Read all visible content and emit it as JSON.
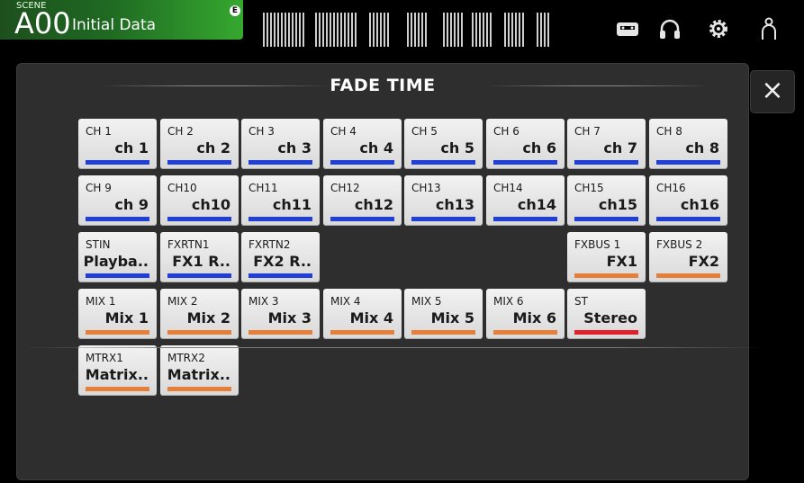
{
  "scene": {
    "label": "SCENE",
    "number": "A00",
    "name": "Initial Data",
    "badge": "E"
  },
  "panel": {
    "title": "FADE TIME",
    "close_label": "×"
  },
  "colors": {
    "blue": "#1f3fd6",
    "orange": "#e57f3a",
    "red": "#e0202a"
  },
  "rows": [
    [
      {
        "id": "CH 1",
        "name": "ch 1",
        "color": "blue"
      },
      {
        "id": "CH 2",
        "name": "ch 2",
        "color": "blue"
      },
      {
        "id": "CH 3",
        "name": "ch 3",
        "color": "blue"
      },
      {
        "id": "CH 4",
        "name": "ch 4",
        "color": "blue"
      },
      {
        "id": "CH 5",
        "name": "ch 5",
        "color": "blue"
      },
      {
        "id": "CH 6",
        "name": "ch 6",
        "color": "blue"
      },
      {
        "id": "CH 7",
        "name": "ch 7",
        "color": "blue"
      },
      {
        "id": "CH 8",
        "name": "ch 8",
        "color": "blue"
      }
    ],
    [
      {
        "id": "CH 9",
        "name": "ch 9",
        "color": "blue"
      },
      {
        "id": "CH10",
        "name": "ch10",
        "color": "blue"
      },
      {
        "id": "CH11",
        "name": "ch11",
        "color": "blue"
      },
      {
        "id": "CH12",
        "name": "ch12",
        "color": "blue"
      },
      {
        "id": "CH13",
        "name": "ch13",
        "color": "blue"
      },
      {
        "id": "CH14",
        "name": "ch14",
        "color": "blue"
      },
      {
        "id": "CH15",
        "name": "ch15",
        "color": "blue"
      },
      {
        "id": "CH16",
        "name": "ch16",
        "color": "blue"
      }
    ],
    [
      {
        "id": "STIN",
        "name": "Playba..",
        "color": "blue"
      },
      {
        "id": "FXRTN1",
        "name": "FX1 R..",
        "color": "blue"
      },
      {
        "id": "FXRTN2",
        "name": "FX2 R..",
        "color": "blue"
      },
      null,
      null,
      null,
      {
        "id": "FXBUS 1",
        "name": "FX1",
        "color": "orange"
      },
      {
        "id": "FXBUS 2",
        "name": "FX2",
        "color": "orange"
      }
    ],
    [
      {
        "id": "MIX 1",
        "name": "Mix 1",
        "color": "orange"
      },
      {
        "id": "MIX 2",
        "name": "Mix 2",
        "color": "orange"
      },
      {
        "id": "MIX 3",
        "name": "Mix 3",
        "color": "orange"
      },
      {
        "id": "MIX 4",
        "name": "Mix 4",
        "color": "orange"
      },
      {
        "id": "MIX 5",
        "name": "Mix 5",
        "color": "orange"
      },
      {
        "id": "MIX 6",
        "name": "Mix 6",
        "color": "orange"
      },
      {
        "id": "ST",
        "name": "Stereo",
        "color": "red"
      }
    ],
    [
      {
        "id": "MTRX1",
        "name": "Matrix..",
        "color": "orange"
      },
      {
        "id": "MTRX2",
        "name": "Matrix..",
        "color": "orange"
      }
    ]
  ],
  "icons": [
    "recorder-icon",
    "headphones-icon",
    "gear-icon",
    "user-icon"
  ]
}
